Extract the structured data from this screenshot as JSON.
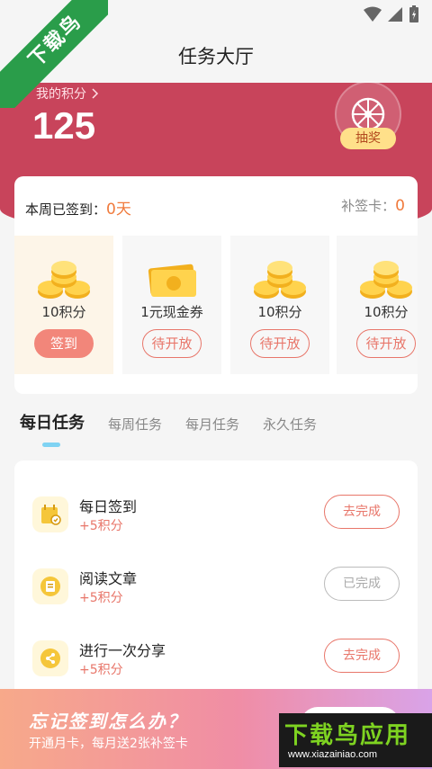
{
  "header": {
    "title": "任务大厅"
  },
  "points": {
    "label": "我的积分",
    "value": "125"
  },
  "lottery": {
    "label": "抽奖"
  },
  "checkin": {
    "week_label": "本周已签到：",
    "week_days": "0天",
    "makeup_label": "补签卡：",
    "makeup_count": "0",
    "days": [
      {
        "reward": "10积分",
        "button": "签到"
      },
      {
        "reward": "1元现金券",
        "button": "待开放"
      },
      {
        "reward": "10积分",
        "button": "待开放"
      },
      {
        "reward": "10积分",
        "button": "待开放"
      }
    ]
  },
  "tabs": [
    "每日任务",
    "每周任务",
    "每月任务",
    "永久任务"
  ],
  "tasks": [
    {
      "name": "每日签到",
      "reward": "+5积分",
      "button": "去完成"
    },
    {
      "name": "阅读文章",
      "reward": "+5积分",
      "button": "已完成"
    },
    {
      "name": "进行一次分享",
      "reward": "+5积分",
      "button": "去完成"
    }
  ],
  "promo": {
    "title": "忘记签到怎么办？",
    "subtitle": "开通月卡，每月送2张补签卡"
  },
  "watermarks": {
    "corner": "下载鸟",
    "bottom": "下载鸟应用",
    "url": "www.xiazainiao.com"
  },
  "colors": {
    "accent": "#c8445b",
    "highlight": "#f07a3c",
    "button_primary": "#f2867a",
    "tab_indicator": "#7fd3f3",
    "watermark_green": "#2a9d4a"
  }
}
